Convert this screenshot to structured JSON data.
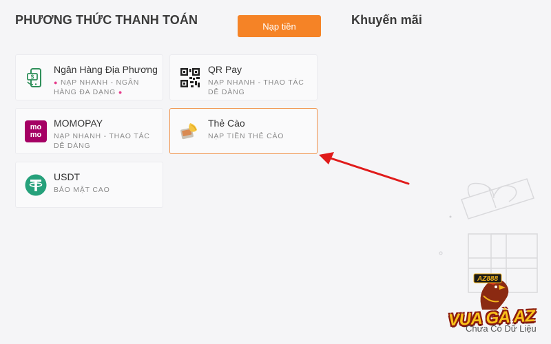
{
  "header": {
    "payment_methods_title": "PHƯƠNG THỨC THANH TOÁN",
    "topup_button": "Nạp tiền",
    "promotions_title": "Khuyến mãi"
  },
  "methods": [
    {
      "name": "Ngân Hàng Địa Phương",
      "sub": "NẠP NHANH - NGÂN HÀNG ĐA DẠNG",
      "icon": "bank-phone-icon"
    },
    {
      "name": "QR Pay",
      "sub": "NẠP NHANH - THAO TÁC DỄ DÀNG",
      "icon": "qr-code-icon"
    },
    {
      "name": "MOMOPAY",
      "sub": "NẠP NHANH - THAO TÁC DỄ DÀNG",
      "icon": "momo-logo-icon",
      "logo_text": "mo mo"
    },
    {
      "name": "Thẻ Cào",
      "sub": "NẠP TIỀN THẺ CÀO",
      "icon": "scratch-card-icon"
    },
    {
      "name": "USDT",
      "sub": "BẢO MẬT CAO",
      "icon": "tether-icon"
    }
  ],
  "selected_method": "Thẻ Cào",
  "promotions": {
    "empty_text": "Chưa Có Dữ Liệu"
  },
  "watermark": {
    "brand": "VUA GÀ AZ",
    "badge": "AZ888"
  },
  "colors": {
    "accent": "#f58326",
    "arrow": "#e01b1b",
    "card_border": "#ebebef",
    "selected_border": "#f0924a",
    "momo": "#a50064",
    "tether": "#26a17b"
  }
}
